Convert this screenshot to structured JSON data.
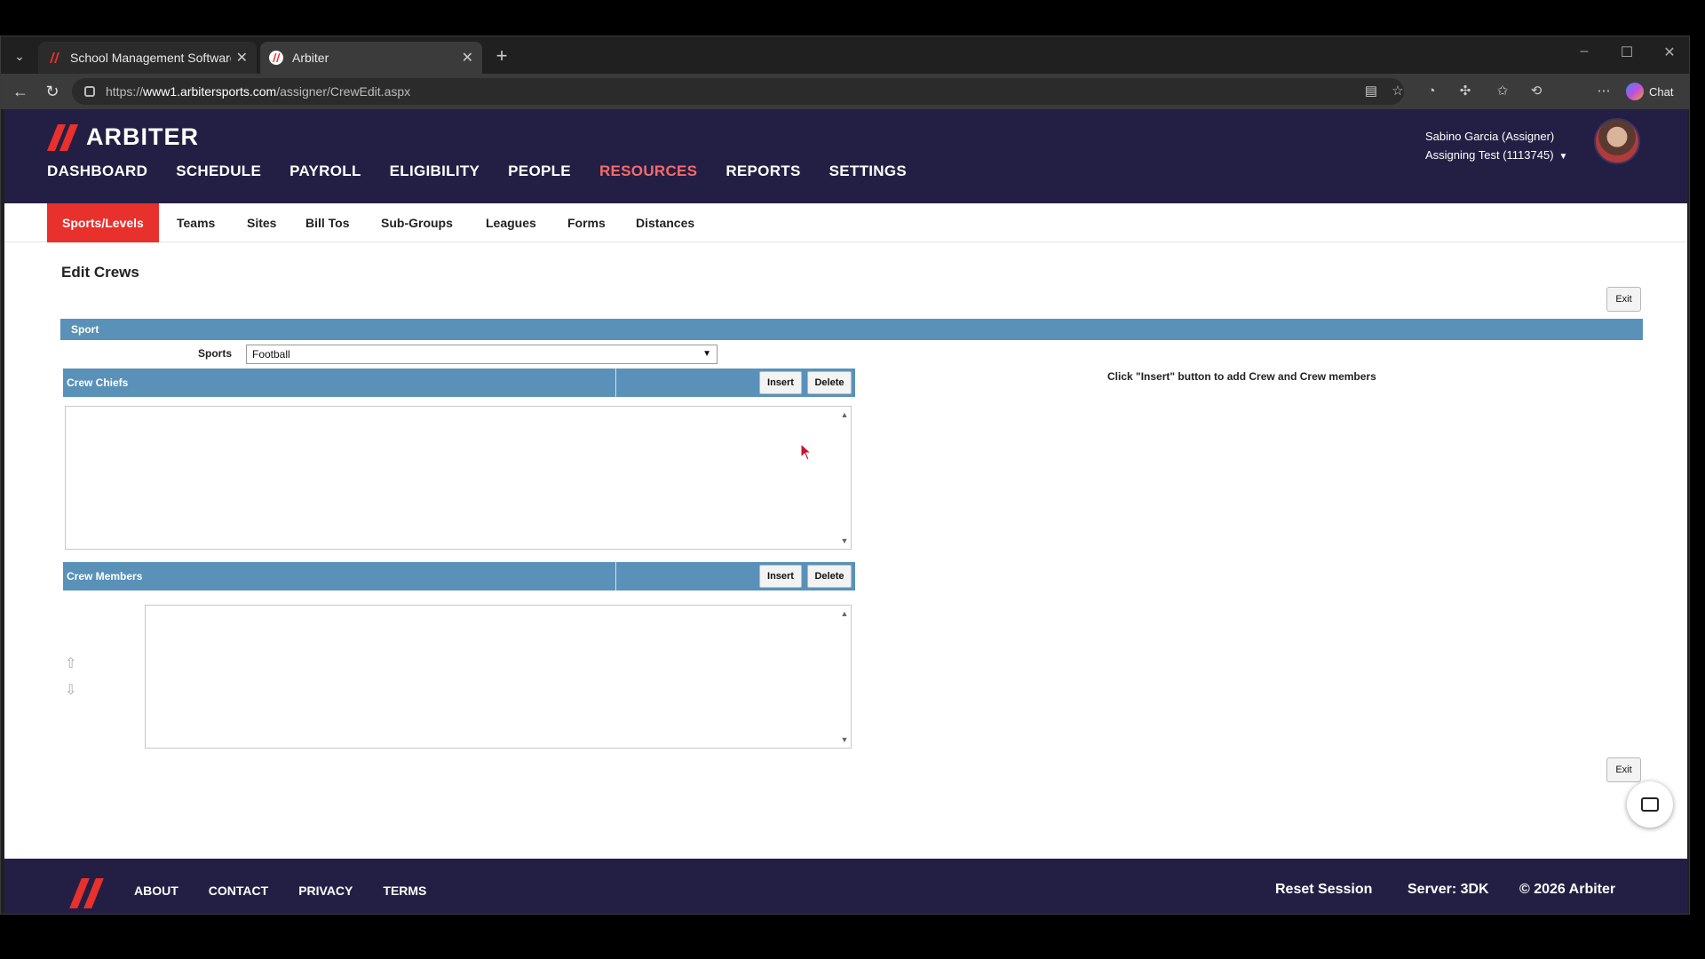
{
  "browser": {
    "tabs": [
      {
        "title": "School Management Software for"
      },
      {
        "title": "Arbiter"
      }
    ],
    "url_prefix": "https://",
    "url_host": "www1.arbitersports.com",
    "url_path": "/assigner/CrewEdit.aspx",
    "chat_label": "Chat"
  },
  "header": {
    "brand": "ARBITER",
    "nav": [
      "DASHBOARD",
      "SCHEDULE",
      "PAYROLL",
      "ELIGIBILITY",
      "PEOPLE",
      "RESOURCES",
      "REPORTS",
      "SETTINGS"
    ],
    "active_nav": "RESOURCES",
    "user_name": "Sabino Garcia (Assigner)",
    "user_group": "Assigning Test (1113745)"
  },
  "subnav": [
    "Sports/Levels",
    "Teams",
    "Sites",
    "Bill Tos",
    "Sub-Groups",
    "Leagues",
    "Forms",
    "Distances"
  ],
  "main": {
    "title": "Edit Crews",
    "exit_label": "Exit",
    "sport_section": "Sport",
    "sports_label": "Sports",
    "sports_selected": "Football",
    "crew_chiefs": {
      "label": "Crew Chiefs",
      "insert": "Insert",
      "delete": "Delete"
    },
    "crew_members": {
      "label": "Crew Members",
      "insert": "Insert",
      "delete": "Delete"
    },
    "hint": "Click \"Insert\" button to add Crew and Crew members"
  },
  "footer": {
    "links": [
      "ABOUT",
      "CONTACT",
      "PRIVACY",
      "TERMS"
    ],
    "reset": "Reset Session",
    "server": "Server: 3DK",
    "copyright": "© 2026 Arbiter"
  },
  "colors": {
    "navy": "#231f44",
    "accent_red": "#e8302c",
    "section_blue": "#5a91b8",
    "active_nav": "#f46b6b"
  }
}
